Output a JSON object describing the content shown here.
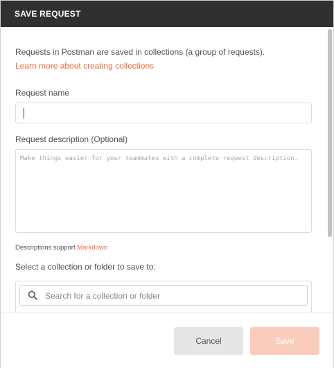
{
  "dialog": {
    "title": "SAVE REQUEST"
  },
  "intro": {
    "text": "Requests in Postman are saved in collections (a group of requests).",
    "link": "Learn more about creating collections"
  },
  "request_name": {
    "label": "Request name",
    "value": ""
  },
  "request_description": {
    "label": "Request description (Optional)",
    "placeholder": "Make things easier for your teammates with a complete request description.",
    "note_prefix": "Descriptions support",
    "note_link": "Markdown"
  },
  "collection_picker": {
    "label": "Select a collection or folder to save to:",
    "search_placeholder": "Search for a collection or folder"
  },
  "footer": {
    "cancel_label": "Cancel",
    "save_label": "Save"
  },
  "colors": {
    "accent": "#f26b3a",
    "header_bg": "#303030",
    "save_disabled": "#f9ccbc"
  },
  "icons": {
    "search": "search-icon"
  }
}
